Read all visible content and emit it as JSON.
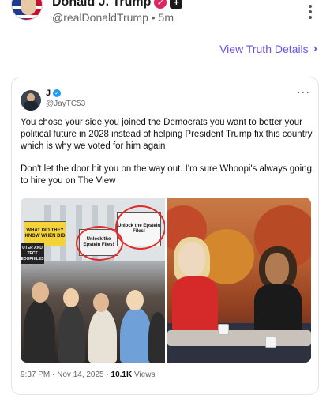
{
  "header": {
    "display_name": "Donald J. Trump",
    "handle": "@realDonaldTrump",
    "separator": "•",
    "time_ago": "5m"
  },
  "view_truth": {
    "label": "View Truth Details"
  },
  "quoted": {
    "name": "J",
    "handle": "@JayTC53",
    "paragraph1": "You chose your side you joined the Democrats you want to better your political future in 2028 instead of helping President Trump fix this country which is why we voted for him again",
    "paragraph2": "Don't let the door hit you on the way out. I'm sure Whoopi's always going to hire you on The View",
    "timestamp": "9:37 PM · Nov 14, 2025 · ",
    "views_count": "10.1K",
    "views_label": " Views"
  },
  "image_signs": {
    "yellow": "WHAT DID THEY KNOW WHEN DID",
    "white1": "Unlock the Epstein Files!",
    "white2": "Unlock the Epstein Files!",
    "black": "UTER AND TECT EDOPHILES"
  },
  "colors": {
    "accent": "#6b52e6",
    "verified_main": "#e0245e",
    "verified_quoted": "#1d9bf0"
  }
}
